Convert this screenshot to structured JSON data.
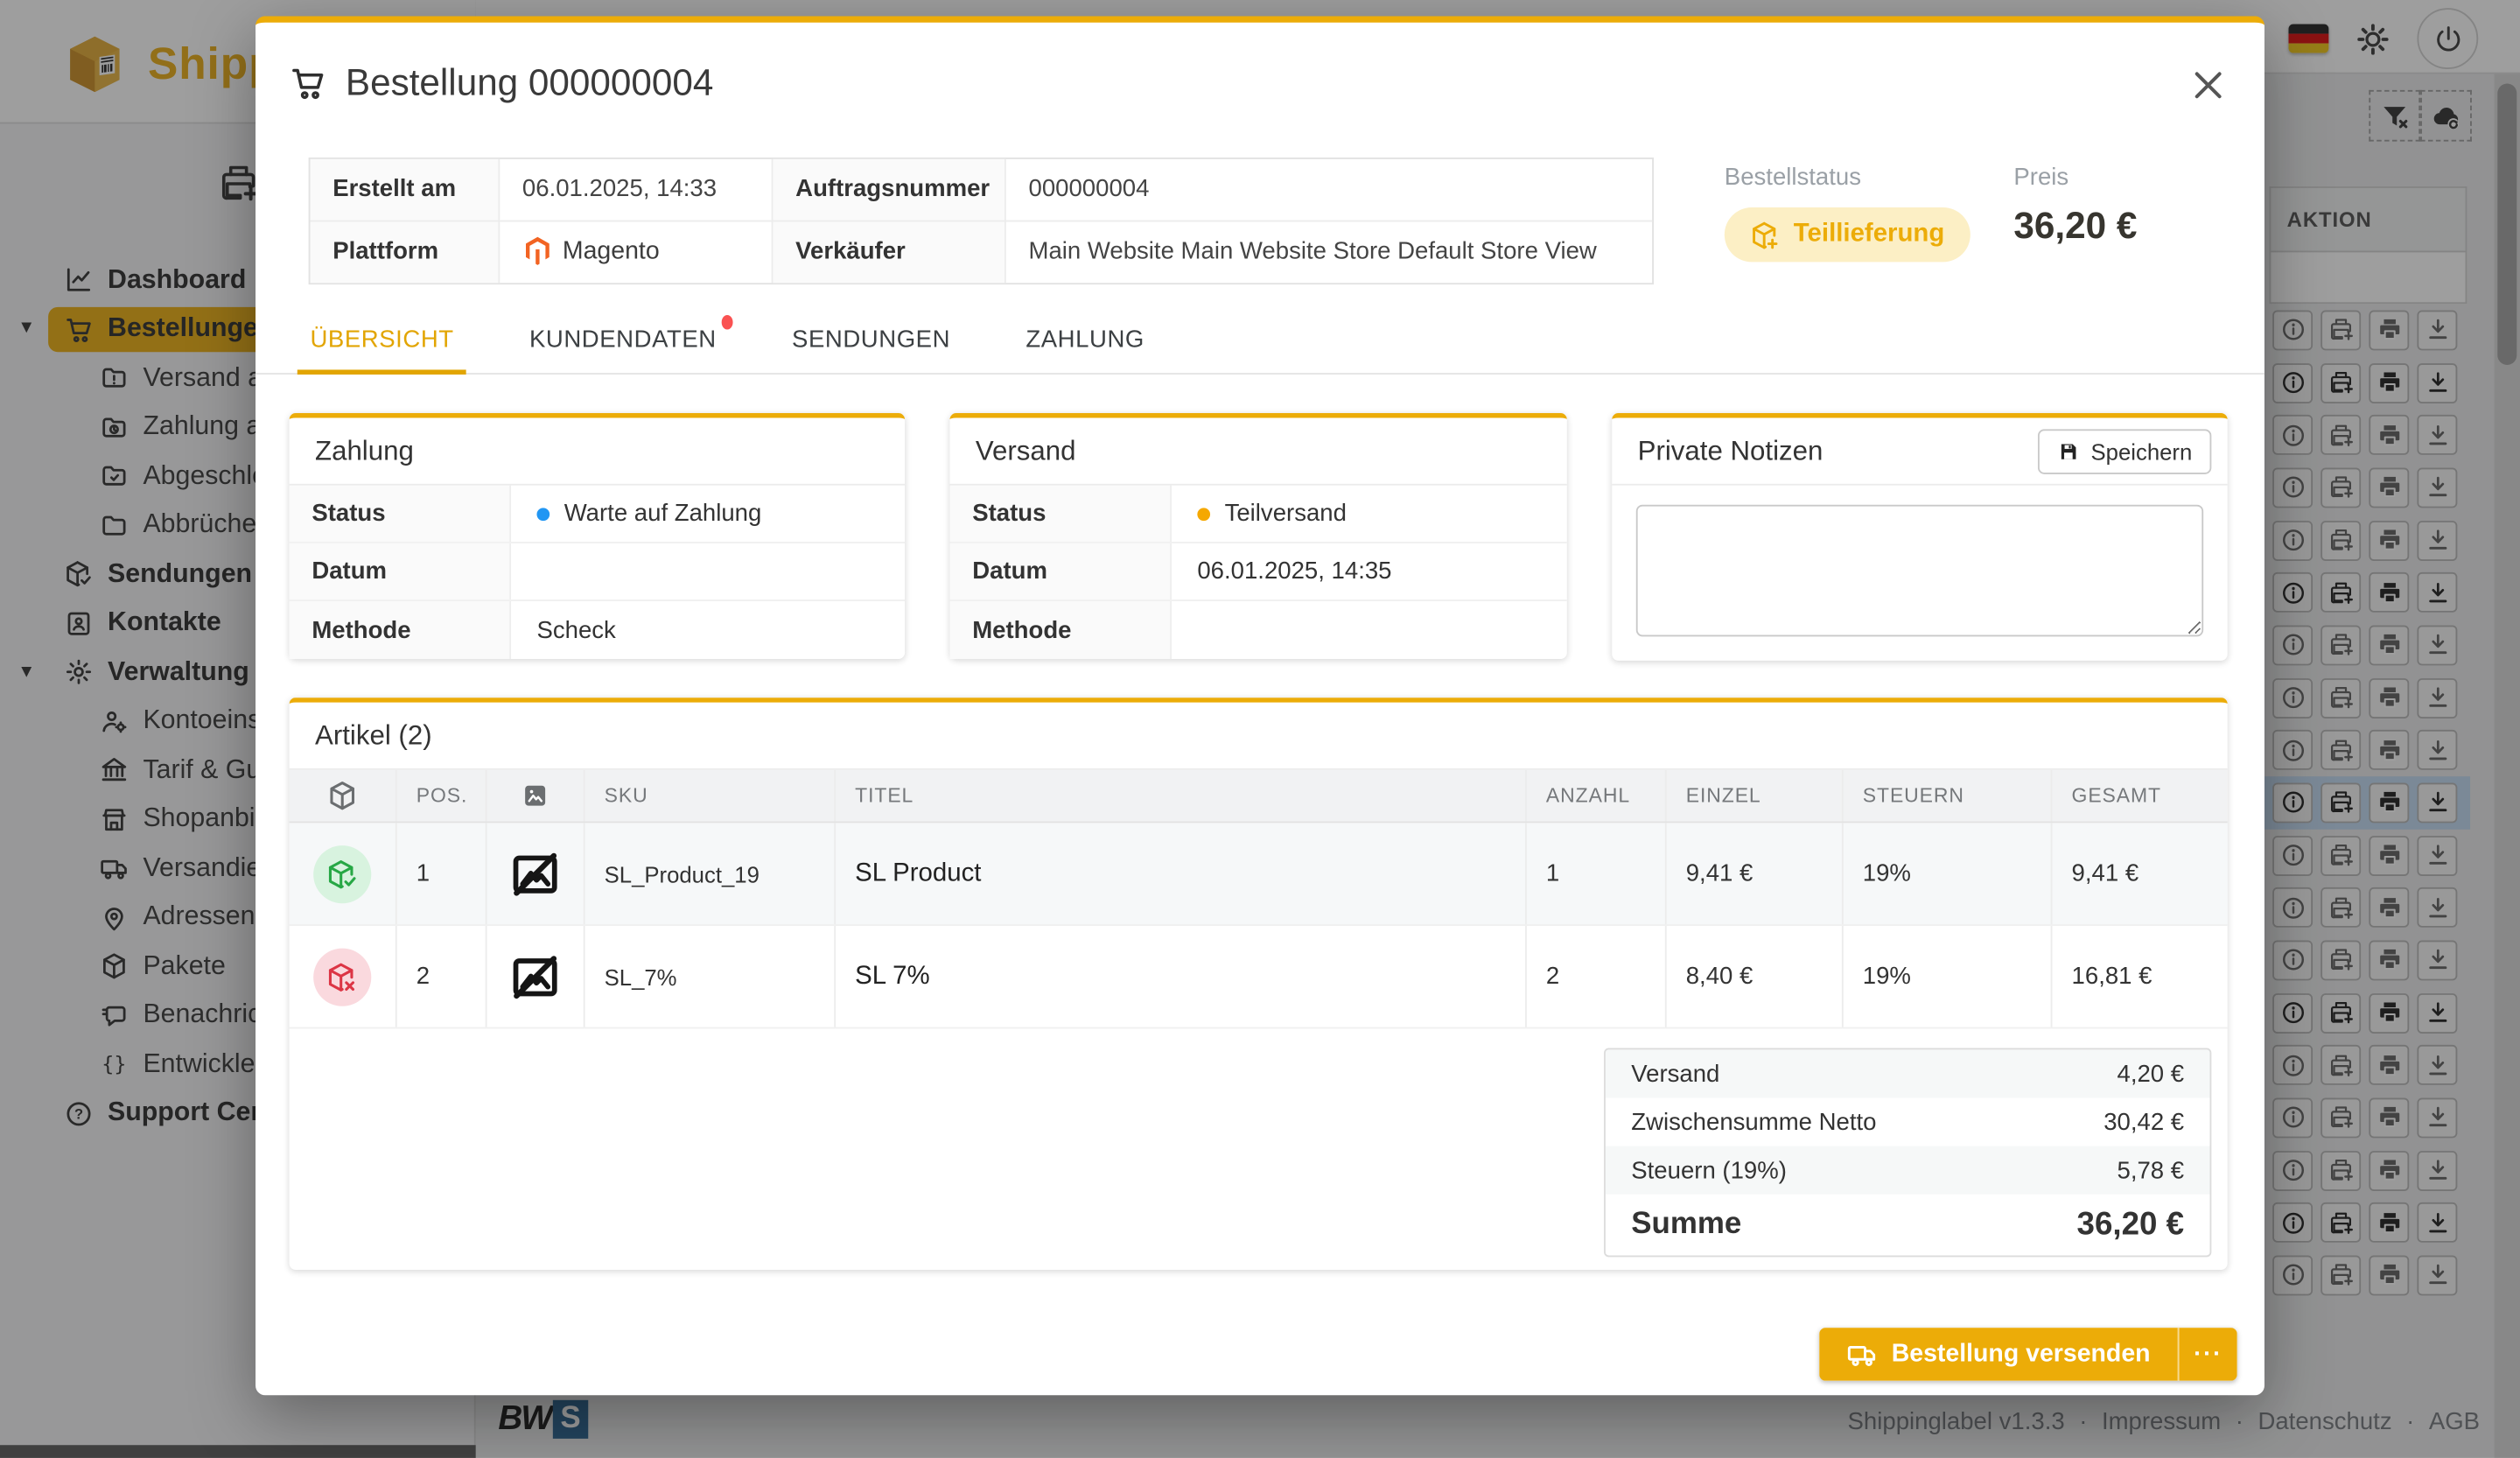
{
  "theme": {
    "accent": "#ECAC08",
    "accent_dark": "#E2A503",
    "badge_bg": "#FCEFC5",
    "blue": "#2196F3",
    "orange": "#F5A800",
    "green": "#27A745",
    "green_bg": "#D8F3DF",
    "red": "#DC3545",
    "red_bg": "#FAD9DE",
    "row_highlight": "#BFD9F2",
    "magento": "#F26322",
    "tab_dot": "#FA5252"
  },
  "topbar": {
    "brand": "Shipp"
  },
  "sidebar": {
    "items": [
      {
        "label": "Dashboard",
        "icon": "chart",
        "level": 1,
        "bold": true
      },
      {
        "label": "Bestellungen (",
        "icon": "cart",
        "level": 1,
        "bold": true,
        "active": true,
        "caret": true
      },
      {
        "label": "Versand aus",
        "icon": "folder-alert",
        "level": 2
      },
      {
        "label": "Zahlung aus",
        "icon": "folder-clock",
        "level": 2
      },
      {
        "label": "Abgeschlos",
        "icon": "folder-check",
        "level": 2
      },
      {
        "label": "Abbrüche / ",
        "icon": "folder",
        "level": 2
      },
      {
        "label": "Sendungen",
        "icon": "package-check",
        "level": 1,
        "bold": true
      },
      {
        "label": "Kontakte",
        "icon": "contact",
        "level": 1,
        "bold": true
      },
      {
        "label": "Verwaltung",
        "icon": "gear",
        "level": 1,
        "bold": true,
        "caret": true
      },
      {
        "label": "Kontoeinste",
        "icon": "user-gear",
        "level": 2
      },
      {
        "label": "Tarif & Guth",
        "icon": "bank",
        "level": 2
      },
      {
        "label": "Shopanbind",
        "icon": "store",
        "level": 2
      },
      {
        "label": "Versandiens",
        "icon": "truck",
        "level": 2
      },
      {
        "label": "Adressen",
        "icon": "pin",
        "level": 2
      },
      {
        "label": "Pakete",
        "icon": "package",
        "level": 2
      },
      {
        "label": "Benachricht",
        "icon": "chat",
        "level": 2
      },
      {
        "label": "Entwickler",
        "icon": "braces",
        "level": 2
      },
      {
        "label": "Support Cente",
        "icon": "help",
        "level": 1,
        "bold": true
      }
    ]
  },
  "background_table": {
    "action_column": "AKTION",
    "rows": [
      {
        "tone": "light"
      },
      {
        "tone": "dark"
      },
      {
        "tone": "light"
      },
      {
        "tone": "light"
      },
      {
        "tone": "light"
      },
      {
        "tone": "dark"
      },
      {
        "tone": "light"
      },
      {
        "tone": "light"
      },
      {
        "tone": "light"
      },
      {
        "tone": "dark",
        "selected": true
      },
      {
        "tone": "light"
      },
      {
        "tone": "light"
      },
      {
        "tone": "light"
      },
      {
        "tone": "dark"
      },
      {
        "tone": "light"
      },
      {
        "tone": "light"
      },
      {
        "tone": "light"
      },
      {
        "tone": "dark"
      },
      {
        "tone": "light"
      }
    ]
  },
  "page_footer": {
    "logo_bw": "BW",
    "logo_s": "S",
    "version": "Shippinglabel v1.3.3",
    "separator": "·",
    "links": [
      "Impressum",
      "Datenschutz",
      "AGB"
    ]
  },
  "modal": {
    "title": "Bestellung 000000004",
    "info": {
      "cells": [
        {
          "label": "Erstellt am",
          "value": "06.01.2025, 14:33"
        },
        {
          "label": "Auftragsnummer",
          "value": "000000004"
        },
        {
          "label": "Plattform",
          "value": "Magento"
        },
        {
          "label": "Verkäufer",
          "value": "Main Website Main Website Store Default Store View"
        }
      ]
    },
    "status": {
      "label": "Bestellstatus",
      "badge": "Teillieferung"
    },
    "price": {
      "label": "Preis",
      "value": "36,20 €"
    },
    "tabs": [
      {
        "label": "ÜBERSICHT",
        "active": true
      },
      {
        "label": "KUNDENDATEN",
        "dot": true
      },
      {
        "label": "SENDUNGEN"
      },
      {
        "label": "ZAHLUNG"
      }
    ],
    "zahlung_card": {
      "title": "Zahlung",
      "rows": [
        {
          "label": "Status",
          "value": "Warte auf Zahlung",
          "dot": "#2196F3"
        },
        {
          "label": "Datum",
          "value": ""
        },
        {
          "label": "Methode",
          "value": "Scheck"
        }
      ]
    },
    "versand_card": {
      "title": "Versand",
      "rows": [
        {
          "label": "Status",
          "value": "Teilversand",
          "dot": "#F5A800"
        },
        {
          "label": "Datum",
          "value": "06.01.2025, 14:35"
        },
        {
          "label": "Methode",
          "value": ""
        }
      ]
    },
    "notes_card": {
      "title": "Private Notizen",
      "save_label": "Speichern",
      "note_value": ""
    },
    "artikel": {
      "title": "Artikel (2)",
      "columns": {
        "pos": "POS.",
        "sku": "SKU",
        "titel": "TITEL",
        "anzahl": "ANZAHL",
        "einzel": "EINZEL",
        "steuern": "STEUERN",
        "gesamt": "GESAMT"
      },
      "rows": [
        {
          "status": "ok",
          "pos": "1",
          "sku": "SL_Product_19",
          "titel": "SL Product",
          "anzahl": "1",
          "einzel": "9,41 €",
          "steuern": "19%",
          "gesamt": "9,41 €"
        },
        {
          "status": "cancel",
          "pos": "2",
          "sku": "SL_7%",
          "titel": "SL 7%",
          "anzahl": "2",
          "einzel": "8,40 €",
          "steuern": "19%",
          "gesamt": "16,81 €"
        }
      ],
      "summary": [
        {
          "label": "Versand",
          "value": "4,20 €"
        },
        {
          "label": "Zwischensumme Netto",
          "value": "30,42 €"
        },
        {
          "label": "Steuern (19%)",
          "value": "5,78 €"
        },
        {
          "label": "Summe",
          "value": "36,20 €",
          "total": true
        }
      ]
    },
    "footer": {
      "send_label": "Bestellung versenden",
      "more_label": "···"
    }
  }
}
